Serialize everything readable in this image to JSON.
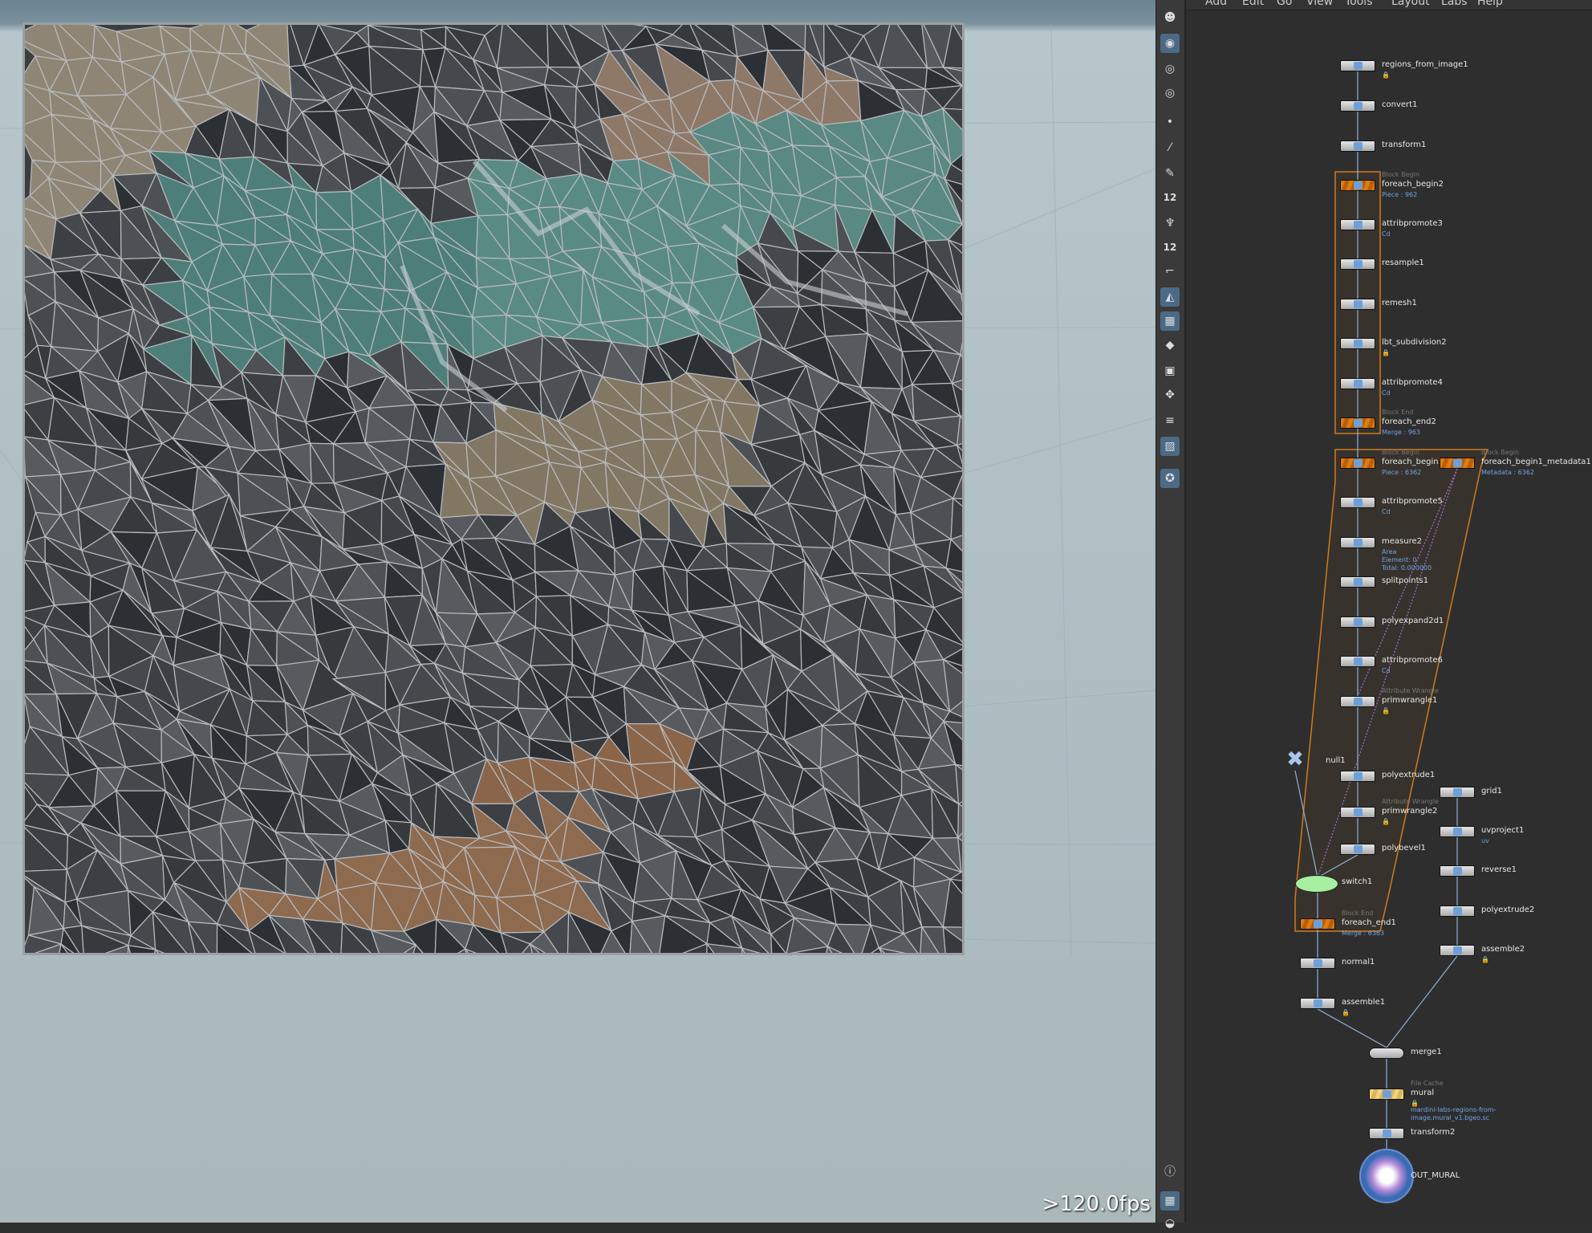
{
  "menu": [
    "Add",
    "Edit",
    "Go",
    "View",
    "Tools",
    "Layout",
    "Labs",
    "Help"
  ],
  "viewport": {
    "fps": ">120.0fps"
  },
  "toolbar_icons": [
    "alien-icon",
    "camera-icon",
    "eye-icon",
    "eye-render-icon",
    "dot-icon",
    "brush-icon",
    "pen-icon",
    "number-icon",
    "paint-icon",
    "number-icon",
    "crop-icon",
    "select-icon",
    "texture-icon",
    "layer-icon",
    "map-icon",
    "pin-icon",
    "lines-icon",
    "image-icon",
    "light-icon",
    "info-icon",
    "grid-icon",
    "disk-icon"
  ],
  "toolbar_labels": {
    "number1": "12",
    "number2": "12"
  },
  "nodes": [
    {
      "id": "regions_from_image1",
      "label": "regions_from_image1",
      "lock": true
    },
    {
      "id": "convert1",
      "label": "convert1"
    },
    {
      "id": "transform1",
      "label": "transform1"
    },
    {
      "id": "foreach_begin2",
      "label": "foreach_begin2",
      "head": "Block Begin",
      "sub": [
        "Piece : 962"
      ]
    },
    {
      "id": "attribpromote3",
      "label": "attribpromote3",
      "sub": [
        "Cd"
      ]
    },
    {
      "id": "resample1",
      "label": "resample1"
    },
    {
      "id": "remesh1",
      "label": "remesh1"
    },
    {
      "id": "lbt_subdivision2",
      "label": "lbt_subdivision2",
      "lock": true
    },
    {
      "id": "attribpromote4",
      "label": "attribpromote4",
      "sub": [
        "Cd"
      ]
    },
    {
      "id": "foreach_end2",
      "label": "foreach_end2",
      "head": "Block End",
      "sub": [
        "Merge : 963"
      ]
    },
    {
      "id": "foreach_begin1",
      "label": "foreach_begin1",
      "head": "Block Begin",
      "sub": [
        "Piece : 6362"
      ]
    },
    {
      "id": "foreach_begin1_metadata1",
      "label": "foreach_begin1_metadata1",
      "head": "Block Begin",
      "sub": [
        "Metadata : 6362"
      ]
    },
    {
      "id": "attribpromote5",
      "label": "attribpromote5",
      "sub": [
        "Cd"
      ]
    },
    {
      "id": "measure2",
      "label": "measure2",
      "sub": [
        "Area",
        "Element: 0",
        "Total: 0.000000"
      ]
    },
    {
      "id": "splitpoints1",
      "label": "splitpoints1"
    },
    {
      "id": "polyexpand2d1",
      "label": "polyexpand2d1"
    },
    {
      "id": "attribpromote6",
      "label": "attribpromote6",
      "sub": [
        "Cd"
      ]
    },
    {
      "id": "primwrangle1",
      "label": "primwrangle1",
      "head": "Attribute Wrangle",
      "lock": true
    },
    {
      "id": "null1",
      "label": "null1"
    },
    {
      "id": "polyextrude1",
      "label": "polyextrude1"
    },
    {
      "id": "primwrangle2",
      "label": "primwrangle2",
      "head": "Attribute Wrangle",
      "lock": true
    },
    {
      "id": "polybevel1",
      "label": "polybevel1"
    },
    {
      "id": "switch1",
      "label": "switch1"
    },
    {
      "id": "foreach_end1",
      "label": "foreach_end1",
      "head": "Block End",
      "sub": [
        "Merge : 6363"
      ]
    },
    {
      "id": "normal1",
      "label": "normal1"
    },
    {
      "id": "assemble1",
      "label": "assemble1",
      "lock": true
    },
    {
      "id": "grid1",
      "label": "grid1"
    },
    {
      "id": "uvproject1",
      "label": "uvproject1",
      "sub": [
        "uv"
      ]
    },
    {
      "id": "reverse1",
      "label": "reverse1"
    },
    {
      "id": "polyextrude2",
      "label": "polyextrude2"
    },
    {
      "id": "assemble2",
      "label": "assemble2",
      "lock": true
    },
    {
      "id": "merge1",
      "label": "merge1"
    },
    {
      "id": "mural",
      "label": "mural",
      "head": "File Cache",
      "lock": true,
      "sub": [
        "mardini-labs-regions-from-",
        "image.mural_v1.bgeo.sc"
      ]
    },
    {
      "id": "transform2",
      "label": "transform2"
    },
    {
      "id": "OUT_MURAL",
      "label": "OUT_MURAL"
    }
  ],
  "colors": {
    "accent": "#4b6a86",
    "block": "#e07b10",
    "link": "#6fa4e6",
    "switch": "#a6f0a0",
    "out": "#3b6bb5"
  }
}
